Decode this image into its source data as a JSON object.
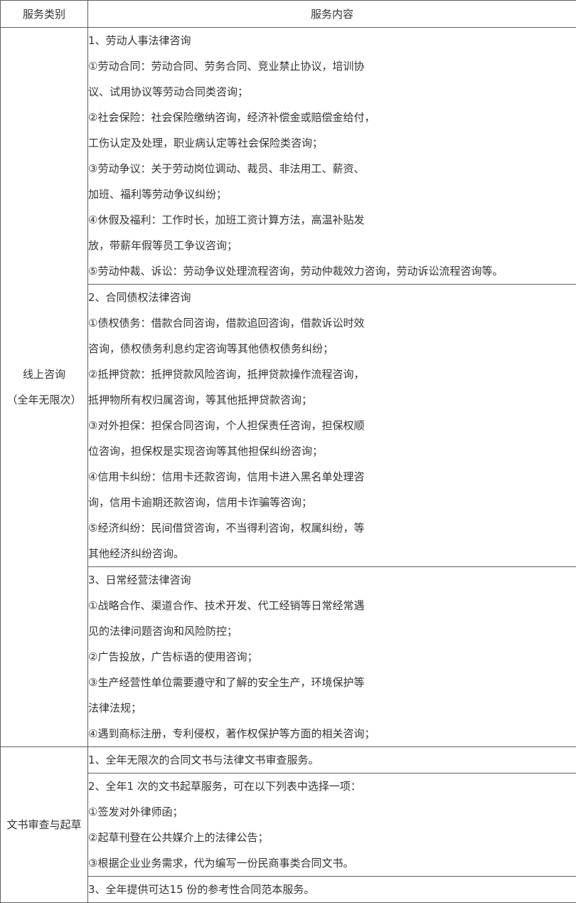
{
  "header": {
    "col_category": "服务类别",
    "col_content": "服务内容"
  },
  "rows": [
    {
      "category_lines": [
        "线上咨询",
        "（全年无限次）"
      ],
      "sections": [
        {
          "lines": [
            "1、劳动人事法律咨询",
            "①劳动合同：劳动合同、劳务合同、竞业禁止协议，培训协",
            "议、试用协议等劳动合同类咨询；",
            "②社会保险：社会保险缴纳咨询，经济补偿金或赔偿金给付，",
            "工伤认定及处理，职业病认定等社会保险类咨询；",
            "③劳动争议：关于劳动岗位调动、裁员、非法用工、薪资、",
            "加班、福利等劳动争议纠纷；",
            "④休假及福利：工作时长，加班工资计算方法，高温补贴发",
            "放，带薪年假等员工争议咨询；",
            "⑤劳动仲裁、诉讼：劳动争议处理流程咨询，劳动仲裁效力咨询，劳动诉讼流程咨询等。"
          ]
        },
        {
          "lines": [
            "2、合同债权法律咨询",
            "①债权债务：借款合同咨询，借款追回咨询，借款诉讼时效",
            "咨询，债权债务利息约定咨询等其他债权债务纠纷；",
            "②抵押贷款：抵押贷款风险咨询，抵押贷款操作流程咨询，",
            "抵押物所有权归属咨询，等其他抵押贷款咨询；",
            "③对外担保：担保合同咨询，个人担保责任咨询，担保权顺",
            "位咨询，担保权是实现咨询等其他担保纠纷咨询；",
            "④信用卡纠纷：信用卡还款咨询，信用卡进入黑名单处理咨",
            "询，信用卡逾期还款咨询，信用卡诈骗等咨询；",
            "⑤经济纠纷：民间借贷咨询，不当得利咨询，权属纠纷，等",
            "其他经济纠纷咨询。"
          ]
        },
        {
          "lines": [
            "3、日常经营法律咨询",
            "①战略合作、渠道合作、技术开发、代工经销等日常经常遇",
            "见的法律问题咨询和风险防控；",
            "②广告投放，广告标语的使用咨询；",
            "③生产经营性单位需要遵守和了解的安全生产，环境保护等",
            "法律法规；",
            "④遇到商标注册，专利侵权，著作权保护等方面的相关咨询；"
          ]
        }
      ]
    },
    {
      "category_lines": [
        "文书审查与起草"
      ],
      "sections": [
        {
          "lines": [
            "1、全年无限次的合同文书与法律文书审查服务。"
          ]
        },
        {
          "lines": [
            "2、全年1 次的文书起草服务，可在以下列表中选择一项：",
            "①签发对外律师函；",
            "②起草刊登在公共媒介上的法律公告；",
            "③根据企业业务需求，代为编写一份民商事类合同文书。"
          ]
        },
        {
          "lines": [
            "3、全年提供可达15 份的参考性合同范本服务。"
          ]
        }
      ]
    }
  ]
}
